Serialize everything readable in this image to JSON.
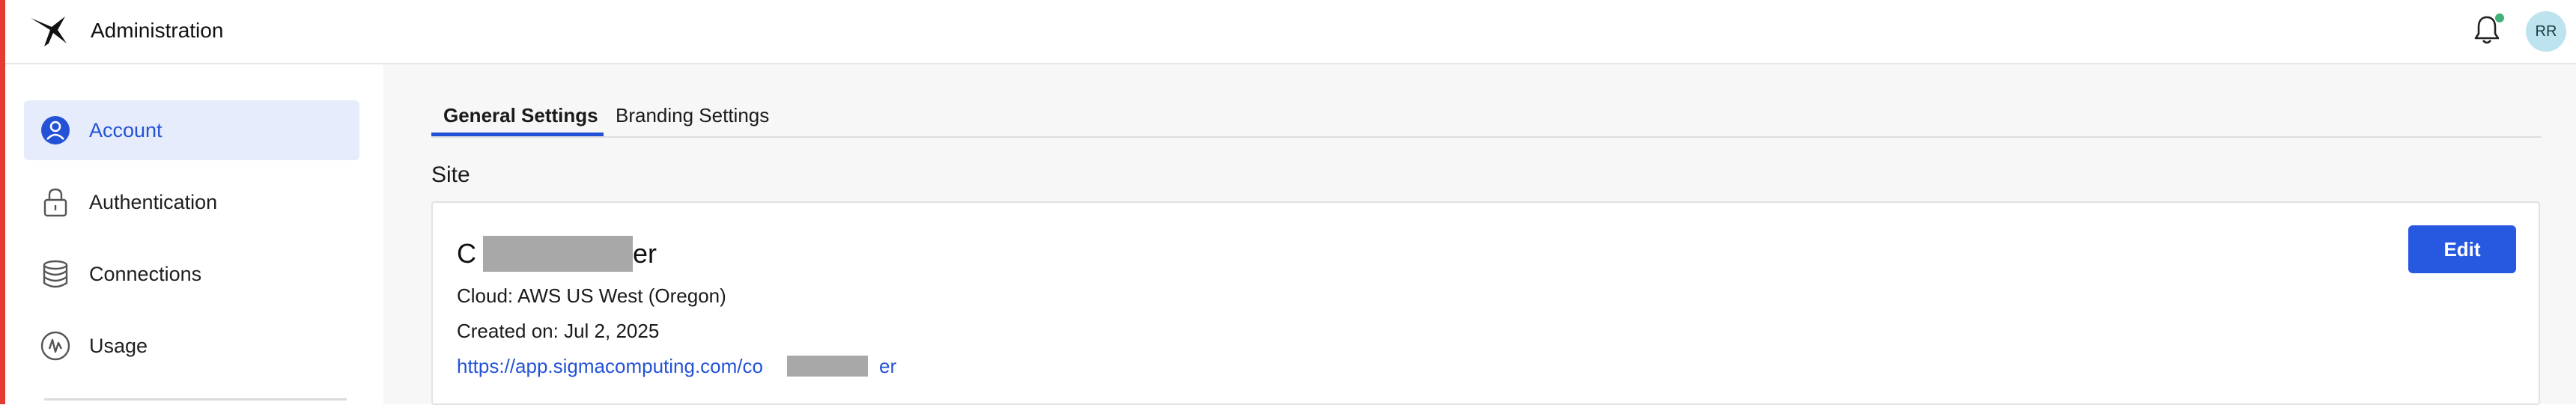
{
  "header": {
    "title": "Administration",
    "logo_icon": "bird-logo-icon",
    "notification_icon": "bell-icon",
    "notification_dot_color": "#44b07a",
    "avatar_initials": "RR"
  },
  "sidebar": {
    "items": [
      {
        "label": "Account",
        "icon": "user-circle-icon",
        "active": true
      },
      {
        "label": "Authentication",
        "icon": "lock-icon",
        "active": false
      },
      {
        "label": "Connections",
        "icon": "database-icon",
        "active": false
      },
      {
        "label": "Usage",
        "icon": "usage-gauge-icon",
        "active": false
      }
    ]
  },
  "tabs": [
    {
      "label": "General Settings",
      "active": true
    },
    {
      "label": "Branding Settings",
      "active": false
    }
  ],
  "site": {
    "section_title": "Site",
    "name_start": "C",
    "name_end": "er",
    "cloud": "Cloud: AWS US West (Oregon)",
    "created": "Created on: Jul 2, 2025",
    "url_start": "https://app.sigmacomputing.com/co",
    "url_end": "er",
    "edit_label": "Edit"
  },
  "colors": {
    "accent": "#2452d6",
    "button": "#2659e0",
    "left_stripe": "#e43b35",
    "active_nav_bg": "#e6ecfc",
    "avatar_bg": "#bde3ee"
  }
}
